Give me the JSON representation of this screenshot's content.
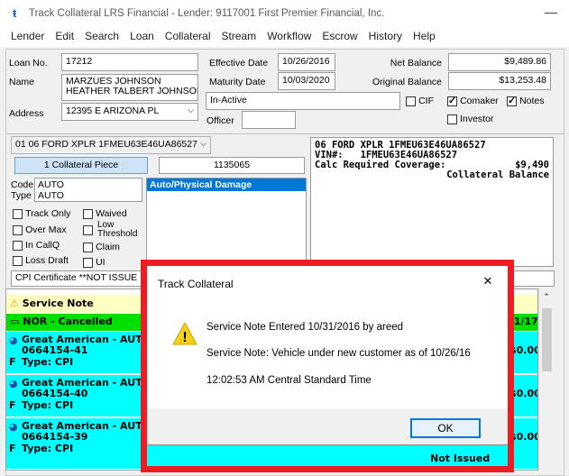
{
  "window": {
    "title": "Track Collateral LRS Financial - Lender: 9117001 First Premier Financial, Inc.",
    "minimize": "—"
  },
  "menu": [
    "Lender",
    "Edit",
    "Search",
    "Loan",
    "Collateral",
    "Stream",
    "Workflow",
    "Escrow",
    "History",
    "Help"
  ],
  "loan": {
    "loan_no_label": "Loan No.",
    "loan_no": "17212",
    "name_label": "Name",
    "name_line1": "MARZUES JOHNSON",
    "name_line2": "HEATHER TALBERT JOHNSON",
    "address_label": "Address",
    "address": "12395 E ARIZONA PL",
    "effective_date_label": "Effective Date",
    "effective_date": "10/26/2016",
    "maturity_date_label": "Maturity Date",
    "maturity_date": "10/03/2020",
    "status": "In-Active",
    "officer_label": "Officer",
    "officer": "",
    "net_balance_label": "Net Balance",
    "net_balance": "$9,489.86",
    "original_balance_label": "Original Balance",
    "original_balance": "$13,253.48",
    "cif_label": "CIF",
    "comaker_label": "Comaker",
    "notes_label": "Notes",
    "investor_label": "Investor",
    "checks": {
      "cif": false,
      "comaker": true,
      "notes": true,
      "investor": false
    }
  },
  "collateral": {
    "selector": "01 06 FORD XPLR 1FMEU63E46UA86527",
    "pieces_button": "1 Collateral Piece",
    "number": "1135065",
    "code_label": "Code",
    "code": "AUTO",
    "type_label": "Type",
    "type": "AUTO",
    "coverage_selected": "Auto/Physical Damage",
    "flags": [
      {
        "label": "Track Only",
        "checked": false
      },
      {
        "label": "Waived",
        "checked": false
      },
      {
        "label": "Over Max",
        "checked": false
      },
      {
        "label": "Low Threshold",
        "checked": false
      },
      {
        "label": "In CallQ",
        "checked": false
      },
      {
        "label": "Claim",
        "checked": false
      },
      {
        "label": "Loss Draft",
        "checked": false
      },
      {
        "label": "UI",
        "checked": false
      }
    ],
    "cpi_certificate": "CPI Certificate **NOT ISSUE",
    "details_line1": "06 FORD XPLR 1FMEU63E46UA86527",
    "details_vin_label": "VIN#:",
    "details_vin": "1FMEU63E46UA86527",
    "calc_label": "Calc Required Coverage:",
    "calc_value": "$9,490",
    "collateral_balance_label": "Collateral Balance"
  },
  "service_list": {
    "header": "Service Note",
    "nor": "NOR - Cancelled",
    "nor_date_frag": "/ 1/17",
    "policies": [
      {
        "carrier": "Great American - AUT",
        "number": "0664154-41",
        "type": "Type: CPI",
        "flag": "F",
        "amount_frag": "$0.00"
      },
      {
        "carrier": "Great American - AUT",
        "number": "0664154-40",
        "type": "Type: CPI",
        "flag": "F",
        "amount_frag": "$0.00"
      },
      {
        "carrier": "Great American - AUT",
        "number": "0664154-39",
        "type": "Type: CPI",
        "flag": "F",
        "amount_frag": "$0.00",
        "status_frag": "Not Issued"
      }
    ],
    "colors": {
      "header_bg": "#ffffc0",
      "nor_bg": "#00e000",
      "policy_bg": "#00ffff"
    }
  },
  "dialog": {
    "title": "Track Collateral",
    "close": "✕",
    "line1": "Service Note Entered 10/31/2016 by areed",
    "line2": "Service Note: Vehicle under new customer as of 10/26/16",
    "line3": "12:02:53 AM Central Standard Time",
    "ok": "OK"
  },
  "colors": {
    "highlight": "#ee1c25",
    "selection": "#0078d7",
    "ok_border": "#0078d7"
  }
}
